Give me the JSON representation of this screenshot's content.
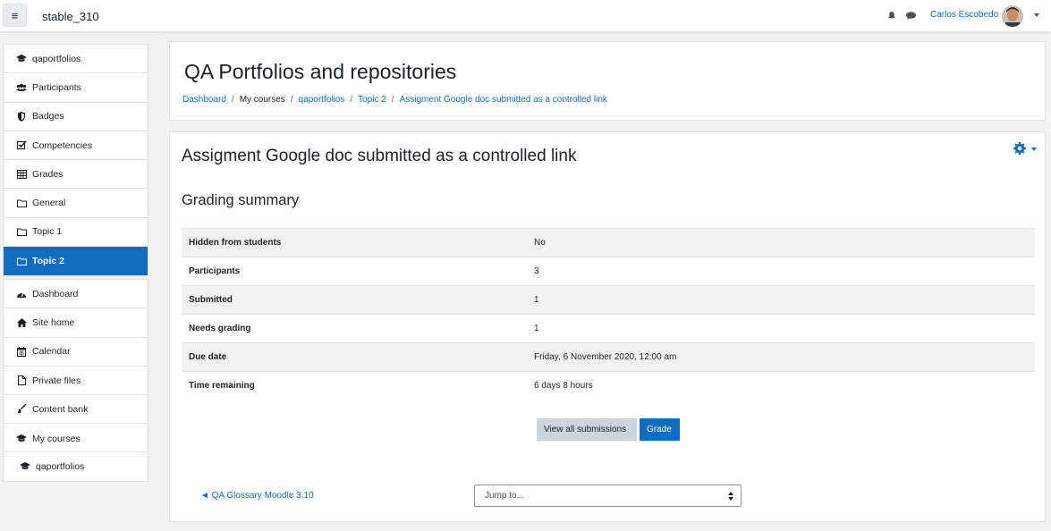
{
  "header": {
    "menu_icon": "hamburger-icon",
    "site_name": "stable_310",
    "notification_icon": "bell-icon",
    "messages_icon": "chat-icon",
    "user_name": "Carlos Escobedo",
    "avatar_icon": "avatar"
  },
  "drawer": {
    "groups": [
      {
        "items": [
          {
            "label": "qaportfolios",
            "icon": "graduation-cap-icon"
          },
          {
            "label": "Participants",
            "icon": "users-icon"
          },
          {
            "label": "Badges",
            "icon": "shield-icon"
          },
          {
            "label": "Competencies",
            "icon": "check-square-icon"
          },
          {
            "label": "Grades",
            "icon": "table-icon"
          },
          {
            "label": "General",
            "icon": "folder-icon"
          },
          {
            "label": "Topic 1",
            "icon": "folder-icon"
          },
          {
            "label": "Topic 2",
            "icon": "folder-icon",
            "active": true
          }
        ]
      },
      {
        "items": [
          {
            "label": "Dashboard",
            "icon": "dashboard-icon"
          },
          {
            "label": "Site home",
            "icon": "home-icon"
          },
          {
            "label": "Calendar",
            "icon": "calendar-icon"
          },
          {
            "label": "Private files",
            "icon": "file-icon"
          },
          {
            "label": "Content bank",
            "icon": "brush-icon"
          },
          {
            "label": "My courses",
            "icon": "graduation-cap-icon"
          }
        ]
      },
      {
        "items": [
          {
            "label": "qaportfolios",
            "icon": "graduation-cap-icon"
          }
        ]
      }
    ]
  },
  "page": {
    "title": "QA Portfolios and repositories",
    "breadcrumb": [
      "Dashboard",
      "My courses",
      "qaportfolios",
      "Topic 2",
      "Assigment Google doc submitted as a controlled link"
    ]
  },
  "activity": {
    "title": "Assigment Google doc submitted as a controlled link",
    "settings_icon": "gear-icon",
    "section_title": "Grading summary",
    "rows": [
      {
        "key": "Hidden from students",
        "value": "No"
      },
      {
        "key": "Participants",
        "value": "3"
      },
      {
        "key": "Submitted",
        "value": "1"
      },
      {
        "key": "Needs grading",
        "value": "1"
      },
      {
        "key": "Due date",
        "value": "Friday, 6 November 2020, 12:00 am"
      },
      {
        "key": "Time remaining",
        "value": "6 days 8 hours"
      }
    ],
    "view_all_label": "View all submissions",
    "grade_label": "Grade",
    "prev_activity": "◄ QA Glossary Moodle 3.10",
    "jump_placeholder": "Jump to..."
  },
  "colors": {
    "primary": "#0f6cbf",
    "secondary_button": "#ced4da",
    "background": "#f2f2f2"
  }
}
